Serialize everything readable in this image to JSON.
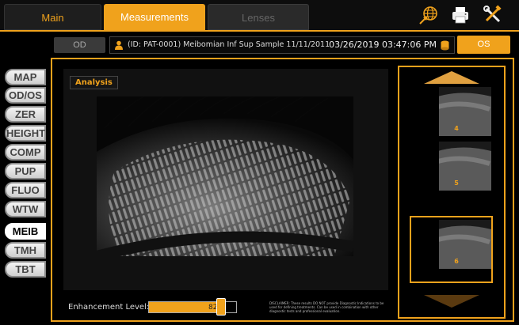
{
  "tabs": {
    "main": "Main",
    "measurements": "Measurements",
    "lenses": "Lenses"
  },
  "icons": {
    "network": "network-globe-icon",
    "print": "printer-icon",
    "tools": "tools-icon"
  },
  "patient": {
    "od_label": "OD",
    "os_label": "OS",
    "info": "(ID: PAT-0001) Meibomian Inf Sup Sample 11/11/2011",
    "datetime": "03/26/2019 03:47:06 PM"
  },
  "menu": [
    "MAP",
    "OD/OS",
    "ZER",
    "HEIGHT",
    "COMP",
    "PUP",
    "FLUO",
    "WTW",
    "MEIB",
    "TMH",
    "TBT"
  ],
  "menu_active": "MEIB",
  "viewer": {
    "analysis_label": "Analysis",
    "enhancement_label": "Enhancement Level:",
    "enhancement_value": "82%",
    "enhancement_fraction": 0.82,
    "disclaimer": "DISCLAIMER: These results DO NOT provide Diagnostic Indications to be used for defining treatments. Can be used in combination with other diagnostic tests and professional evaluation."
  },
  "thumbnails": [
    {
      "number": "4"
    },
    {
      "number": "5"
    },
    {
      "number": "6",
      "selected": true
    }
  ],
  "colors": {
    "accent": "#f0a21c",
    "background": "#000000"
  }
}
